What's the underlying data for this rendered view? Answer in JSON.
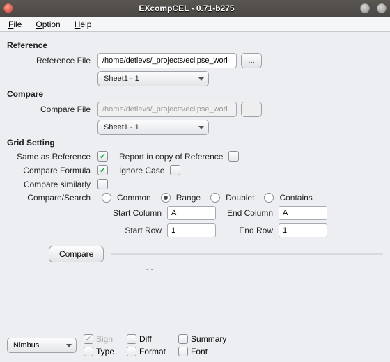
{
  "window": {
    "title": "EXcompCEL - 0.71-b275"
  },
  "menu": {
    "file": "File",
    "option": "Option",
    "help": "Help"
  },
  "reference": {
    "title": "Reference",
    "file_label": "Reference File",
    "file_value": "/home/detlevs/_projects/eclipse_worl",
    "browse": "...",
    "sheet": "Sheet1 - 1"
  },
  "compare": {
    "title": "Compare",
    "file_label": "Compare File",
    "file_value": "/home/detlevs/_projects/eclipse_worl",
    "browse": "...",
    "sheet": "Sheet1 - 1"
  },
  "grid": {
    "title": "Grid Setting",
    "same_as_ref": "Same as Reference",
    "report_copy": "Report in copy of Reference",
    "compare_formula": "Compare Formula",
    "ignore_case": "Ignore Case",
    "compare_similarly": "Compare similarly",
    "compare_search": "Compare/Search",
    "radios": {
      "common": "Common",
      "range": "Range",
      "doublet": "Doublet",
      "contains": "Contains"
    },
    "start_col_label": "Start Column",
    "start_col": "A",
    "end_col_label": "End Column",
    "end_col": "A",
    "start_row_label": "Start Row",
    "start_row": "1",
    "end_row_label": "End Row",
    "end_row": "1"
  },
  "action": {
    "compare": "Compare",
    "dots": "- -"
  },
  "footer": {
    "theme": "Nimbus",
    "sign": "Sign",
    "diff": "Diff",
    "summary": "Summary",
    "type": "Type",
    "format": "Format",
    "font": "Font"
  }
}
